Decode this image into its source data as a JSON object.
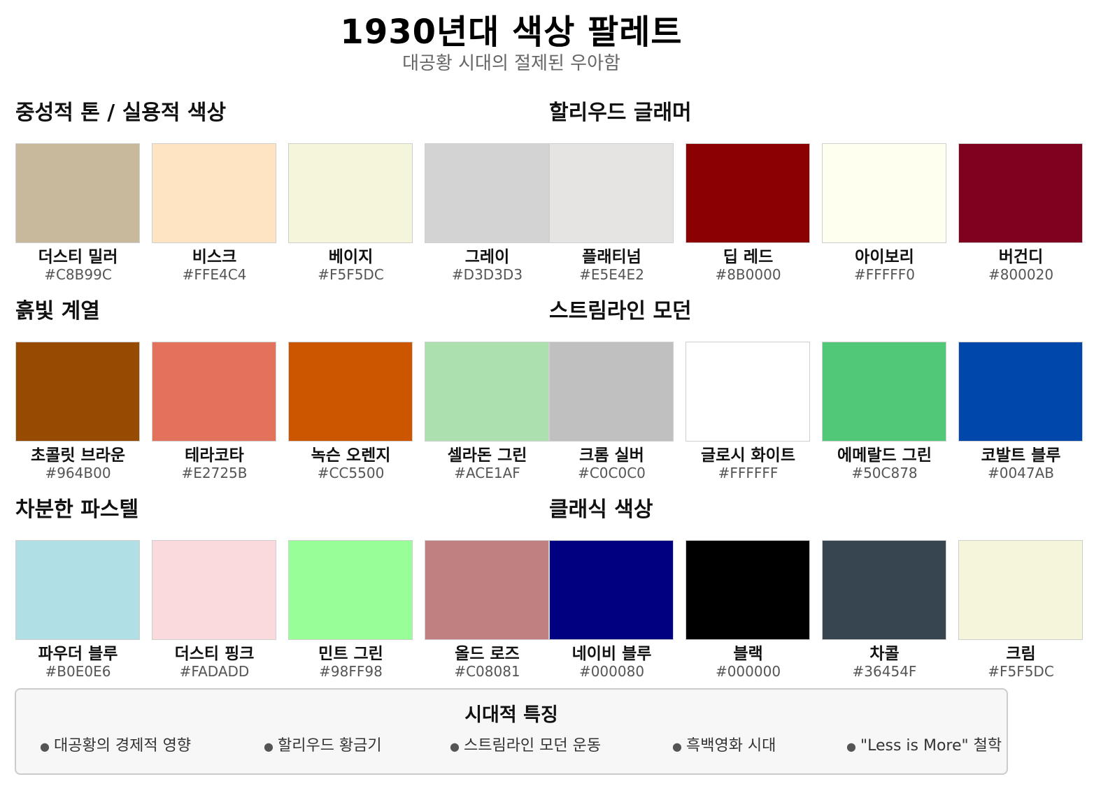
{
  "header": {
    "title": "1930년대 색상 팔레트",
    "subtitle": "대공황 시대의 절제된 우아함"
  },
  "groups": [
    {
      "title": "중성적 톤 / 실용적 색상"
    },
    {
      "title": "할리우드 글래머"
    },
    {
      "title": "흙빛 계열"
    },
    {
      "title": "스트림라인 모던"
    },
    {
      "title": "차분한 파스텔"
    },
    {
      "title": "클래식 색상"
    }
  ],
  "rows": [
    [
      {
        "name": "더스티 밀러",
        "hex": "#C8B99C"
      },
      {
        "name": "비스크",
        "hex": "#FFE4C4"
      },
      {
        "name": "베이지",
        "hex": "#F5F5DC"
      },
      {
        "name": "그레이",
        "hex": "#D3D3D3"
      },
      {
        "name": "플래티넘",
        "hex": "#E5E4E2"
      },
      {
        "name": "딥 레드",
        "hex": "#8B0000"
      },
      {
        "name": "아이보리",
        "hex": "#FFFFF0"
      },
      {
        "name": "버건디",
        "hex": "#800020"
      }
    ],
    [
      {
        "name": "초콜릿 브라운",
        "hex": "#964B00"
      },
      {
        "name": "테라코타",
        "hex": "#E2725B"
      },
      {
        "name": "녹슨 오렌지",
        "hex": "#CC5500"
      },
      {
        "name": "셀라돈 그린",
        "hex": "#ACE1AF"
      },
      {
        "name": "크롬 실버",
        "hex": "#C0C0C0"
      },
      {
        "name": "글로시 화이트",
        "hex": "#FFFFFF"
      },
      {
        "name": "에메랄드 그린",
        "hex": "#50C878"
      },
      {
        "name": "코발트 블루",
        "hex": "#0047AB"
      }
    ],
    [
      {
        "name": "파우더 블루",
        "hex": "#B0E0E6"
      },
      {
        "name": "더스티 핑크",
        "hex": "#FADADD"
      },
      {
        "name": "민트 그린",
        "hex": "#98FF98"
      },
      {
        "name": "올드 로즈",
        "hex": "#C08081"
      },
      {
        "name": "네이비 블루",
        "hex": "#000080"
      },
      {
        "name": "블랙",
        "hex": "#000000"
      },
      {
        "name": "차콜",
        "hex": "#36454F"
      },
      {
        "name": "크림",
        "hex": "#F5F5DC"
      }
    ]
  ],
  "features": {
    "title": "시대적 특징",
    "items": [
      "대공황의 경제적 영향",
      "할리우드 황금기",
      "스트림라인 모던 운동",
      "흑백영화 시대",
      "\"Less is More\" 철학"
    ]
  }
}
